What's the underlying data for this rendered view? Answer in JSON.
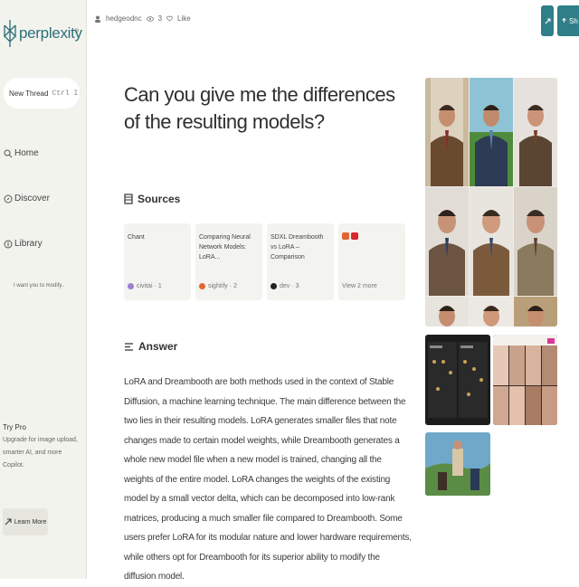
{
  "app": {
    "brand": "perplexity",
    "collapse_glyph": "»"
  },
  "sidebar": {
    "new_thread_label": "New Thread",
    "new_thread_shortcut": "Ctrl I",
    "nav": [
      {
        "label": "Home",
        "icon": "search-icon"
      },
      {
        "label": "Discover",
        "icon": "compass-icon"
      },
      {
        "label": "Library",
        "icon": "library-icon"
      }
    ],
    "hint_text": "I want you to modify..",
    "pro_title": "Try Pro",
    "pro_lines": [
      "Upgrade for image upload,",
      "smarter AI, and more",
      "Copilot."
    ],
    "learn_more_label": "Learn More"
  },
  "topbar": {
    "author": "hedgeodnc",
    "views": "3",
    "like_label": "Like",
    "share_label": "Sh"
  },
  "thread": {
    "question": "Can you give me the differences of the resulting models?",
    "sources_heading": "Sources",
    "answer_heading": "Answer",
    "answer_text": "LoRA and Dreambooth are both methods used in the context of Stable Diffusion, a machine learning technique. The main difference between the two lies in their resulting models. LoRA generates smaller files that note changes made to certain model weights, while Dreambooth generates a whole new model file when a new model is trained, changing all the weights of the entire model. LoRA changes the weights of the existing model by a small vector delta, which can be decomposed into low-rank matrices, producing a much smaller file compared to Dreambooth. Some users prefer LoRA for its modular nature and lower hardware requirements, while others opt for Dreambooth for its superior ability to modify the diffusion model.",
    "sources": [
      {
        "title": "Chant",
        "site": "civitai",
        "index": "1",
        "color": "#9b7fd1"
      },
      {
        "title": "Comparing Neural Network Models: LoRA...",
        "site": "sightify",
        "index": "2",
        "color": "#e0662f"
      },
      {
        "title": "SDXL Dreambooth vs LoRA – Comparison",
        "site": "dev",
        "index": "3",
        "color": "#222222"
      }
    ],
    "view_more_label": "View 2 more"
  },
  "colors": {
    "accent": "#2f7f88",
    "sidebar_bg": "#f3f3ee",
    "card_bg": "#f3f3ef"
  }
}
